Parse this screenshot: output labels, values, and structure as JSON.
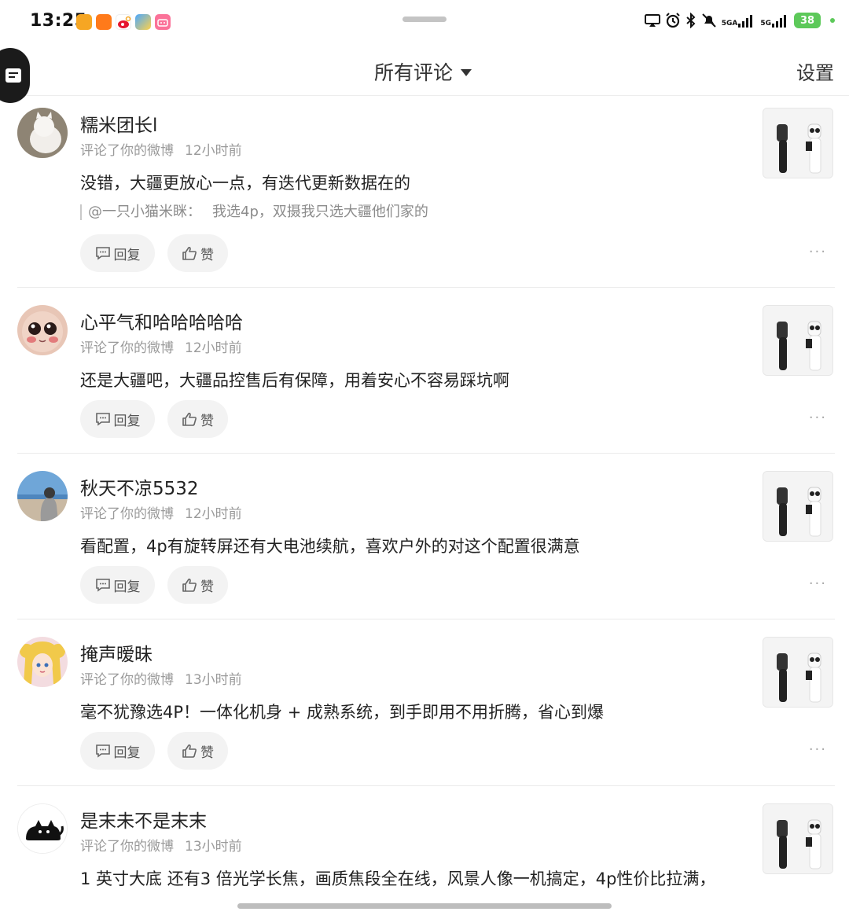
{
  "status_bar": {
    "time": "13:25",
    "network_labels": [
      "5GA",
      "5G"
    ],
    "battery": "38",
    "app_icons": [
      "orange-app-icon",
      "taobao-app-icon",
      "weibo-app-icon",
      "browser-app-icon",
      "bilibili-app-icon"
    ]
  },
  "header": {
    "title": "所有评论",
    "settings": "设置"
  },
  "colors": {
    "background": "#ffffff",
    "text_primary": "#222222",
    "text_secondary": "#9a9a9a",
    "pill_bg": "#f3f3f3",
    "battery": "#5dc95a"
  },
  "actions": {
    "reply": "回复",
    "like": "赞",
    "more": "···"
  },
  "comments": [
    {
      "user": "糯米团长l",
      "action": "评论了你的微博",
      "time": "12小时前",
      "text": "没错，大疆更放心一点，有迭代更新数据在的",
      "quote_user": "@一只小猫米眯：",
      "quote_text": "我选4p，双摄我只选大疆他们家的"
    },
    {
      "user": "心平气和哈哈哈哈哈",
      "action": "评论了你的微博",
      "time": "12小时前",
      "text": "还是大疆吧，大疆品控售后有保障，用着安心不容易踩坑啊"
    },
    {
      "user": "秋天不凉5532",
      "action": "评论了你的微博",
      "time": "12小时前",
      "text": "看配置，4p有旋转屏还有大电池续航，喜欢户外的对这个配置很满意"
    },
    {
      "user": "掩声暧昧",
      "action": "评论了你的微博",
      "time": "13小时前",
      "text": "毫不犹豫选4P！一体化机身 + 成熟系统，到手即用不用折腾，省心到爆"
    },
    {
      "user": "是末未不是末末",
      "action": "评论了你的微博",
      "time": "13小时前",
      "text": "1 英寸大底 还有3 倍光学长焦，画质焦段全在线，风景人像一机搞定，4p性价比拉满，"
    }
  ]
}
